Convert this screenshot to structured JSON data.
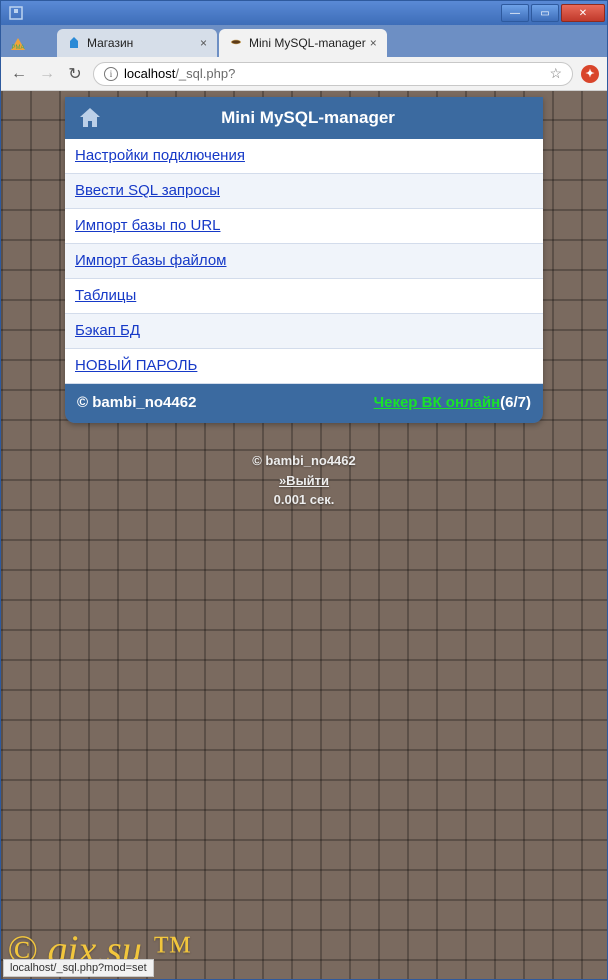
{
  "window": {
    "buttons": {
      "min": "—",
      "max": "▭",
      "close": "✕"
    }
  },
  "tabs": [
    {
      "title": "Магазин",
      "active": false
    },
    {
      "title": "Mini MySQL-manager",
      "active": true
    }
  ],
  "address": {
    "host": "localhost",
    "path": "/_sql.php?"
  },
  "panel": {
    "title": "Mini MySQL-manager",
    "menu": [
      "Настройки подключения",
      "Ввести SQL запросы",
      "Импорт базы по URL",
      "Импорт базы файлом",
      "Таблицы",
      "Бэкап БД",
      "НОВЫЙ ПАРОЛЬ"
    ],
    "footer": {
      "credit": "© bambi_no4462",
      "checker_label": "Чекер ВК онлайн",
      "counter": "(6/7)"
    }
  },
  "page_footer": {
    "credit": "© bambi_no4462",
    "logout": "»Выйти",
    "timing": "0.001 сек."
  },
  "watermark": "© gix.su ™",
  "statusbar": "localhost/_sql.php?mod=set"
}
